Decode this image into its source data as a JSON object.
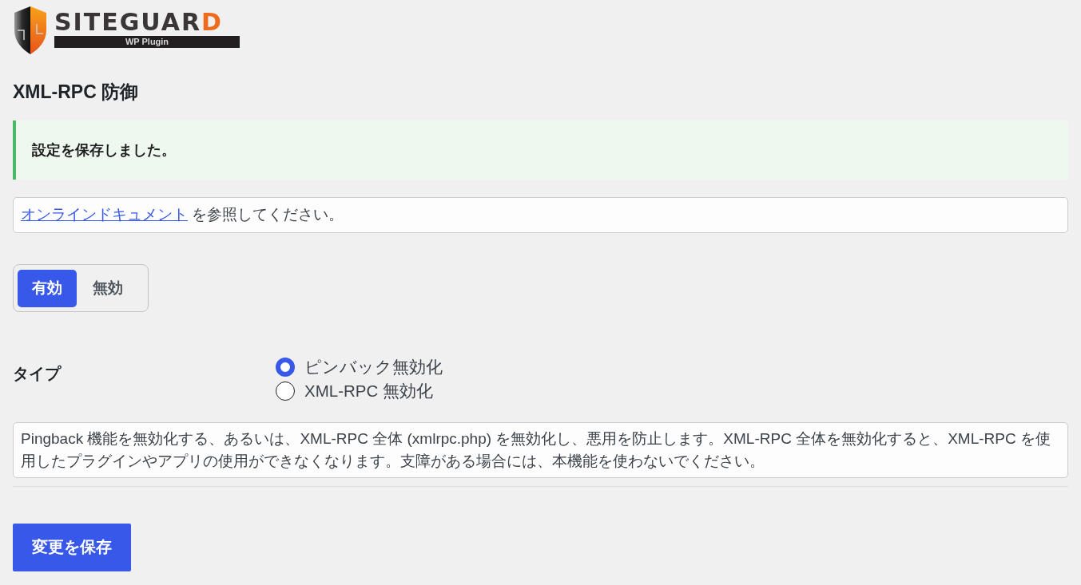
{
  "logo": {
    "wordmark": "SITEGUARD",
    "subtitle": "WP Plugin"
  },
  "page_title": "XML-RPC 防御",
  "notice": {
    "message": "設定を保存しました。"
  },
  "info_box": {
    "link": "オンラインドキュメント",
    "text": "を参照してください。"
  },
  "mode_toggle": [
    {
      "label": "有効",
      "selected": true
    },
    {
      "label": "無効",
      "selected": false
    }
  ],
  "type_setting": {
    "label": "タイプ",
    "options": [
      {
        "label": "ピンバック無効化",
        "selected": true
      },
      {
        "label": "XML-RPC 無効化",
        "selected": false
      }
    ]
  },
  "description": "Pingback 機能を無効化する、あるいは、XML-RPC 全体 (xmlrpc.php) を無効化し、悪用を防止します。XML-RPC 全体を無効化すると、XML-RPC を使用したプラグインやアプリの使用ができなくなります。支障がある場合には、本機能を使わないでください。",
  "save_button": "変更を保存"
}
